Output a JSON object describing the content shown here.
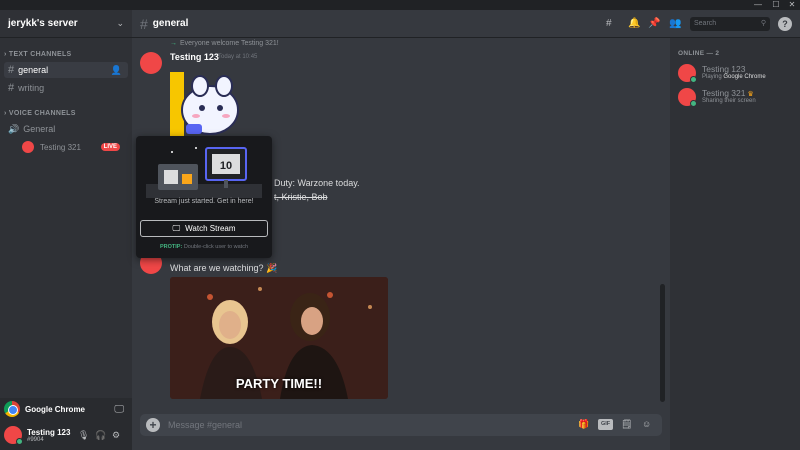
{
  "window": {
    "minimize": "—",
    "maximize": "☐",
    "close": "✕"
  },
  "server": {
    "name": "jerykk's server"
  },
  "sidebar": {
    "text_category": "TEXT CHANNELS",
    "voice_category": "VOICE CHANNELS",
    "text_channels": [
      {
        "name": "general"
      },
      {
        "name": "writing"
      }
    ],
    "voice_channels": [
      {
        "name": "General",
        "users": [
          {
            "name": "Testing 321",
            "badge": "LIVE"
          }
        ]
      }
    ]
  },
  "activity": {
    "name": "Google Chrome"
  },
  "user": {
    "name": "Testing 123",
    "tag": "#9904"
  },
  "header": {
    "channel": "general",
    "search_placeholder": "Search",
    "help": "?"
  },
  "messages": {
    "system": "Everyone welcome Testing 321!",
    "first_author": "Testing 123",
    "first_time": "Today at 10:45",
    "line_partial": "Duty: Warzone today.",
    "line_strike": "t, Kristie, Bob",
    "second_text": "What are we watching?",
    "gif_caption": "PARTY TIME!!"
  },
  "popup": {
    "cta": "Stream just started. Get in here!",
    "button": "Watch Stream",
    "tip_label": "PROTIP:",
    "tip_text": "Double-click user to watch"
  },
  "composer": {
    "placeholder": "Message #general",
    "gif": "GIF"
  },
  "members": {
    "heading": "ONLINE — 2",
    "list": [
      {
        "name": "Testing 123",
        "status_prefix": "Playing",
        "status_bold": "Google Chrome"
      },
      {
        "name": "Testing 321",
        "status_prefix": "Sharing their screen",
        "status_bold": ""
      }
    ]
  },
  "colors": {
    "accent": "#f04747",
    "online": "#43b581",
    "live": "#f04747"
  }
}
